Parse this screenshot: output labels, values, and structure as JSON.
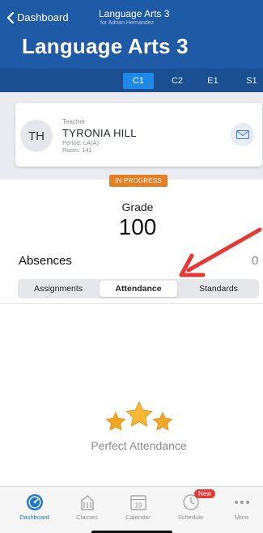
{
  "nav": {
    "back_label": "Dashboard",
    "title": "Language Arts 3",
    "subtitle": "for Adrian Hernandez",
    "large_title": "Language Arts 3"
  },
  "terms": {
    "items": [
      "C1",
      "C2",
      "E1",
      "S1"
    ],
    "active": "C1"
  },
  "teacher": {
    "initials": "TH",
    "role": "Teacher",
    "name": "TYRONIA HILL",
    "period": "Period: LA(A)",
    "room": "Room: 141"
  },
  "status_badge": "IN PROGRESS",
  "grade": {
    "label": "Grade",
    "value": "100"
  },
  "absences": {
    "label": "Absences",
    "value": "0"
  },
  "segments": {
    "items": [
      "Assignments",
      "Attendance",
      "Standards"
    ],
    "active": "Attendance"
  },
  "attendance": {
    "message": "Perfect Attendance"
  },
  "tabbar": {
    "items": [
      {
        "label": "Dashboard",
        "icon": "dashboard-gauge-icon"
      },
      {
        "label": "Classes",
        "icon": "classes-building-icon"
      },
      {
        "label": "Calendar",
        "icon": "calendar-icon",
        "day": "19"
      },
      {
        "label": "Schedule",
        "icon": "schedule-clock-icon",
        "badge": "New"
      },
      {
        "label": "More",
        "icon": "more-dots-icon"
      }
    ],
    "active": "Dashboard"
  },
  "colors": {
    "header_bg": "#1f5aa6",
    "term_active": "#1e88e5",
    "badge": "#e67e22",
    "arrow": "#e53935",
    "stars": "#f5a623",
    "tab_active": "#1e78d0"
  }
}
